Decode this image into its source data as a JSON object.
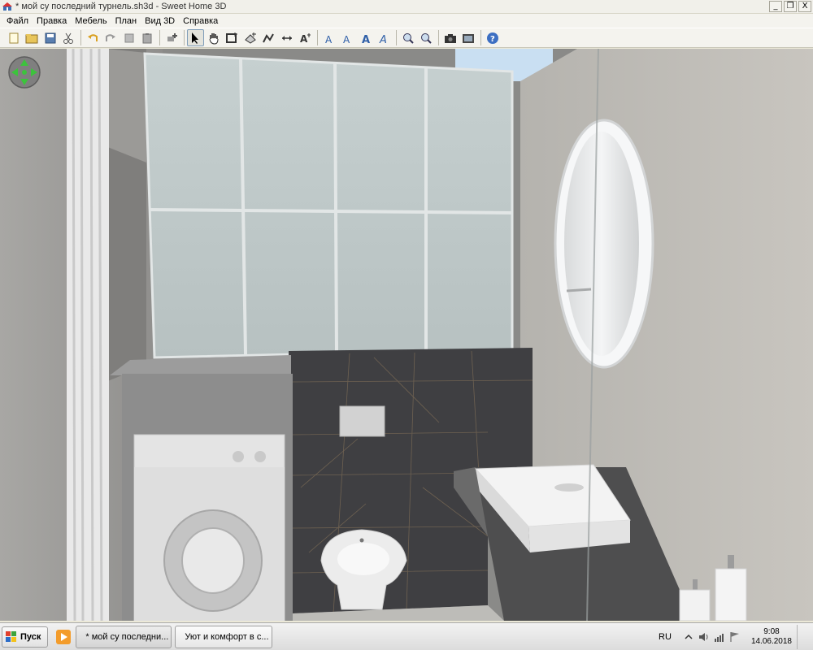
{
  "window": {
    "title": "* мой су последний турнель.sh3d - Sweet Home 3D",
    "minimize_glyph": "_",
    "maximize_glyph": "❐",
    "close_glyph": "X"
  },
  "menu": {
    "items": [
      "Файл",
      "Правка",
      "Мебель",
      "План",
      "Вид 3D",
      "Справка"
    ]
  },
  "toolbar": {
    "buttons": [
      {
        "name": "new-home-icon"
      },
      {
        "name": "open-icon"
      },
      {
        "name": "save-icon"
      },
      {
        "name": "cut-icon"
      },
      {
        "name": "undo-icon"
      },
      {
        "name": "redo-icon"
      },
      {
        "name": "copy-icon"
      },
      {
        "name": "paste-icon"
      },
      {
        "name": "add-furniture-icon"
      },
      {
        "name": "select-mode-icon",
        "active": true
      },
      {
        "name": "pan-mode-icon"
      },
      {
        "name": "create-walls-icon"
      },
      {
        "name": "create-rooms-icon"
      },
      {
        "name": "create-polylines-icon"
      },
      {
        "name": "create-dimensions-icon"
      },
      {
        "name": "add-text-icon"
      },
      {
        "name": "increase-text-icon"
      },
      {
        "name": "decrease-text-icon"
      },
      {
        "name": "bold-text-icon"
      },
      {
        "name": "italic-text-icon"
      },
      {
        "name": "zoom-in-icon"
      },
      {
        "name": "zoom-out-icon"
      },
      {
        "name": "create-photo-icon"
      },
      {
        "name": "create-video-icon"
      },
      {
        "name": "help-icon"
      }
    ]
  },
  "taskbar": {
    "start_label": "Пуск",
    "tasks": [
      {
        "label": "* мой су последни...",
        "icon": "sweet-home-3d-icon",
        "active": true
      },
      {
        "label": "Уют и комфорт в с...",
        "icon": "yandex-browser-icon",
        "active": false
      }
    ],
    "language": "RU",
    "time": "9:08",
    "date": "14.06.2018"
  },
  "colors": {
    "accent_toolbar_border": "#7f9db9",
    "tile_dark": "#3f3f42",
    "wall_concrete": "#bdbab5"
  }
}
